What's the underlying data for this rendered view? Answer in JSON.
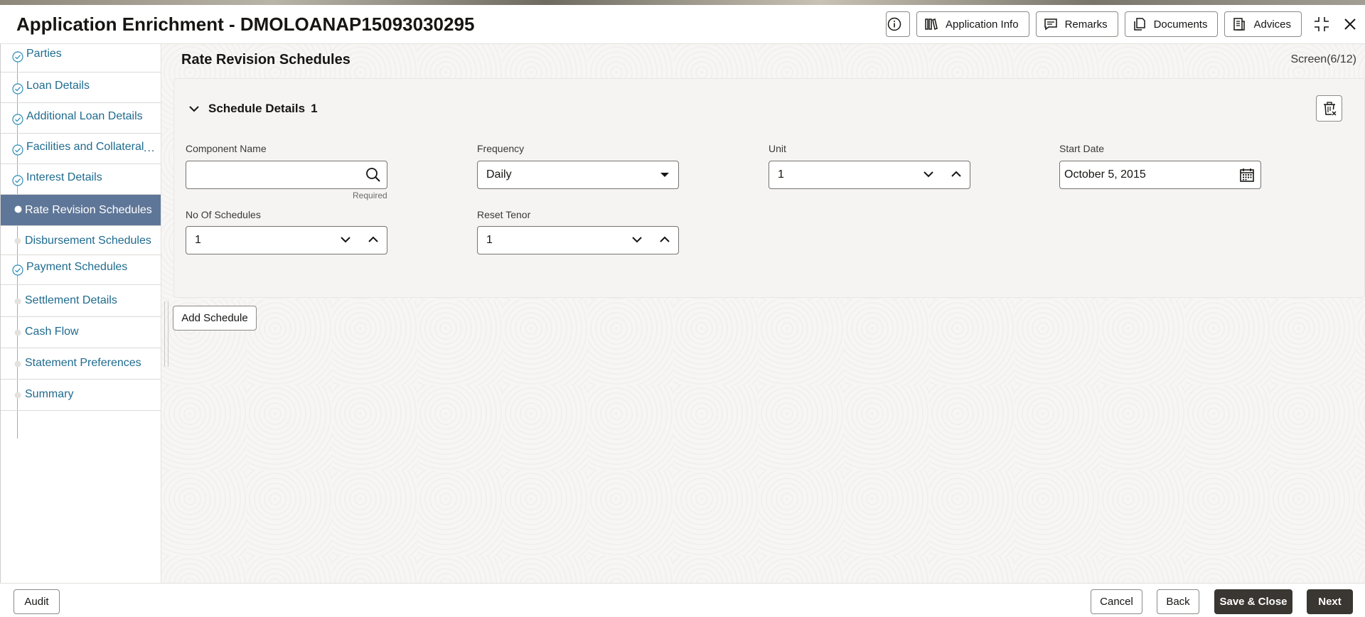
{
  "header": {
    "title": "Application Enrichment - DMOLOANAP15093030295",
    "buttons": {
      "application_info": "Application Info",
      "remarks": "Remarks",
      "documents": "Documents",
      "advices": "Advices"
    }
  },
  "sidebar": {
    "items": [
      {
        "label": "Parties",
        "state": "done"
      },
      {
        "label": "Loan Details",
        "state": "done"
      },
      {
        "label": "Additional Loan Details",
        "state": "done"
      },
      {
        "label": "Facilities and Collateral",
        "state": "done",
        "truncation": "..."
      },
      {
        "label": "Interest Details",
        "state": "done"
      },
      {
        "label": "Rate Revision Schedules",
        "state": "active"
      },
      {
        "label": "Disbursement Schedules",
        "state": "pending"
      },
      {
        "label": "Payment Schedules",
        "state": "done"
      },
      {
        "label": "Settlement Details",
        "state": "pending"
      },
      {
        "label": "Cash Flow",
        "state": "pending"
      },
      {
        "label": "Statement Preferences",
        "state": "pending"
      },
      {
        "label": "Summary",
        "state": "pending"
      }
    ]
  },
  "main": {
    "page_title": "Rate Revision Schedules",
    "screen_counter": "Screen(6/12)",
    "section": {
      "title": "Schedule Details",
      "number": "1"
    },
    "fields": {
      "component_name": {
        "label": "Component Name",
        "value": "",
        "hint": "Required"
      },
      "frequency": {
        "label": "Frequency",
        "value": "Daily"
      },
      "unit": {
        "label": "Unit",
        "value": "1"
      },
      "start_date": {
        "label": "Start Date",
        "value": "October 5, 2015"
      },
      "no_of_schedules": {
        "label": "No Of Schedules",
        "value": "1"
      },
      "reset_tenor": {
        "label": "Reset Tenor",
        "value": "1"
      }
    },
    "add_schedule_label": "Add Schedule"
  },
  "footer": {
    "audit": "Audit",
    "cancel": "Cancel",
    "back": "Back",
    "save_close": "Save & Close",
    "next": "Next"
  },
  "colors": {
    "active_nav_bg": "#5e7697",
    "nav_link": "#1f5c80",
    "primary_button": "#3a3631",
    "check_color": "#2e8db5"
  }
}
